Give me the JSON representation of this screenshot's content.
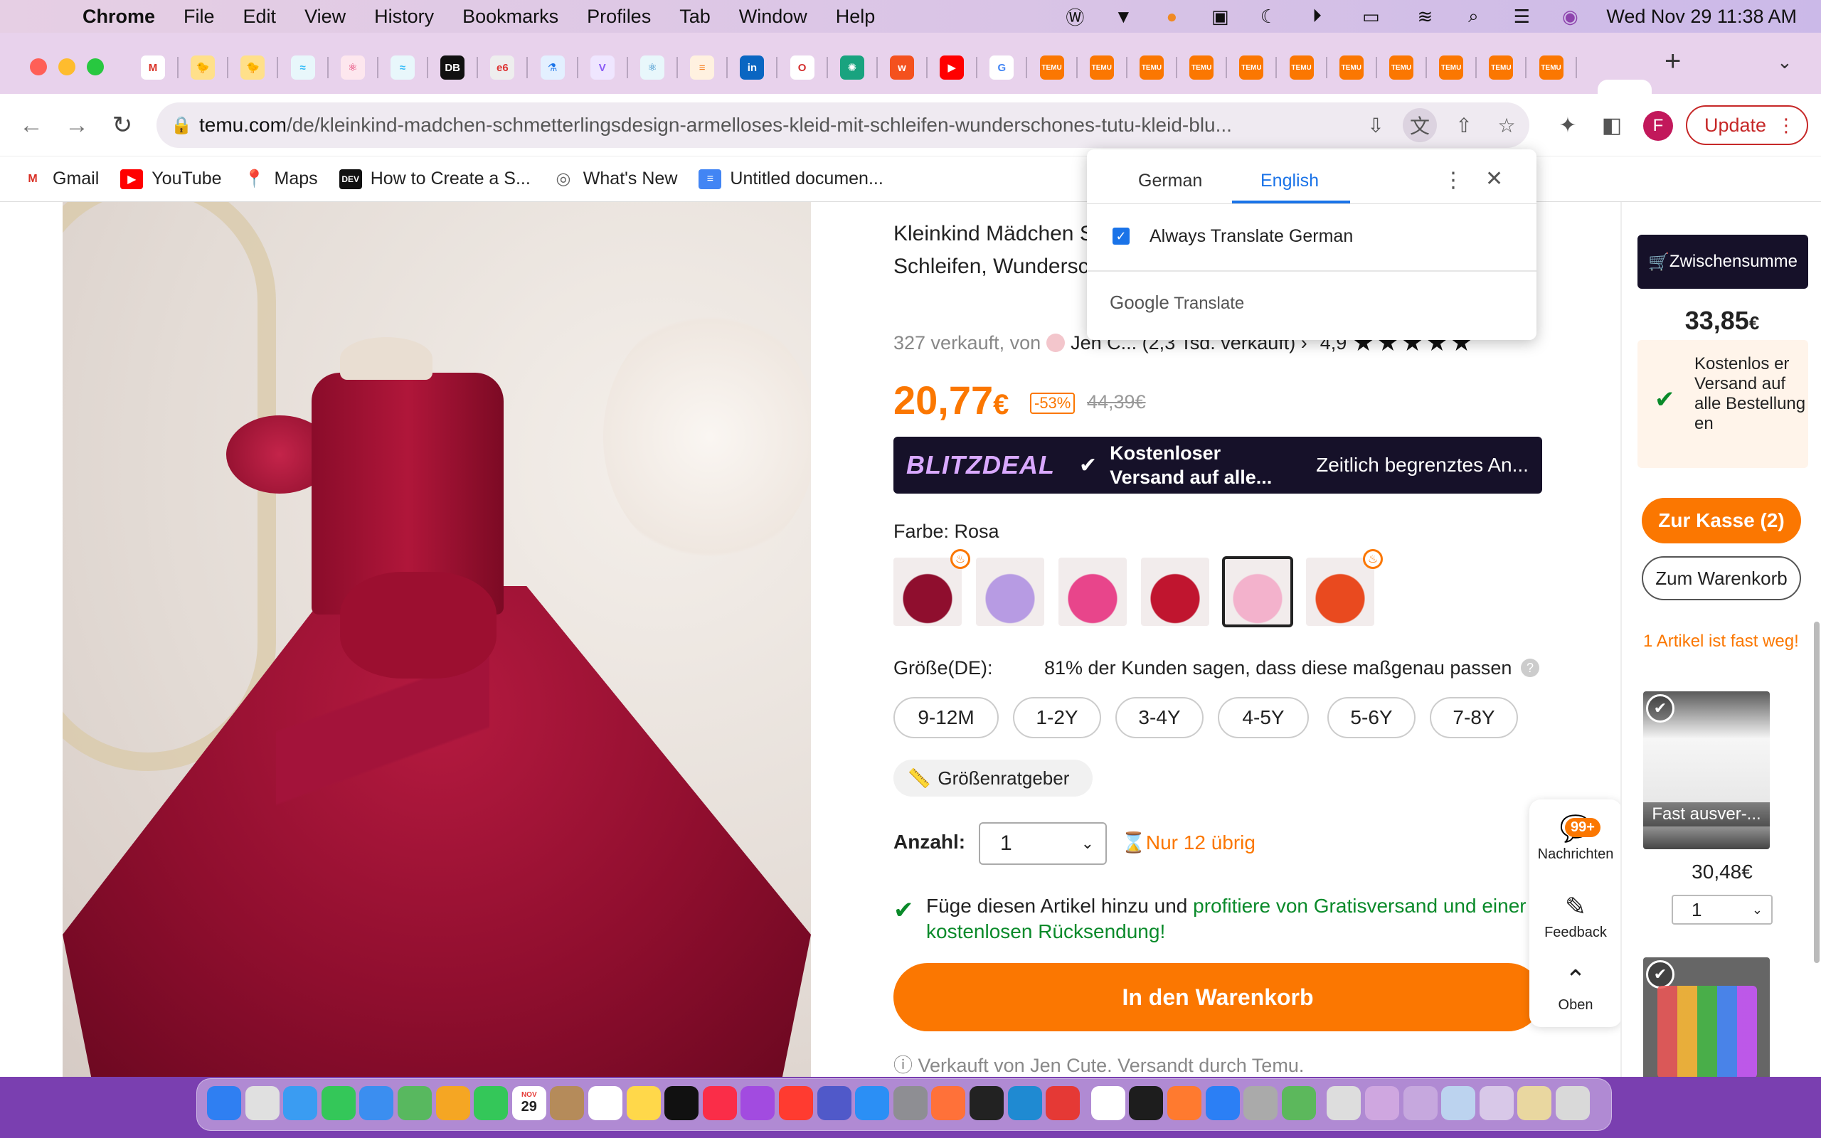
{
  "menubar": {
    "app": "Chrome",
    "items": [
      "File",
      "Edit",
      "View",
      "History",
      "Bookmarks",
      "Profiles",
      "Tab",
      "Window",
      "Help"
    ],
    "datetime": "Wed Nov 29  11:38 AM"
  },
  "tabs": [
    {
      "icon": "gmail-icon",
      "glyph": "M",
      "color": "#ffffff",
      "fg": "#d93025"
    },
    {
      "icon": "chick-icon",
      "glyph": "🐤",
      "color": "#ffe08a",
      "fg": "#333"
    },
    {
      "icon": "chick-icon",
      "glyph": "🐤",
      "color": "#ffe08a",
      "fg": "#333"
    },
    {
      "icon": "tailwind-icon",
      "glyph": "≈",
      "color": "#e8f7fb",
      "fg": "#38bdf8"
    },
    {
      "icon": "react-icon",
      "glyph": "⚛",
      "color": "#fde7ee",
      "fg": "#e0245e"
    },
    {
      "icon": "tailwind-icon",
      "glyph": "≈",
      "color": "#e8f7fb",
      "fg": "#38bdf8"
    },
    {
      "icon": "db-icon",
      "glyph": "DB",
      "color": "#111111",
      "fg": "#fff"
    },
    {
      "icon": "e6-icon",
      "glyph": "e6",
      "color": "#eeeeee",
      "fg": "#d33"
    },
    {
      "icon": "flask-icon",
      "glyph": "⚗",
      "color": "#e3f0ff",
      "fg": "#1a73e8"
    },
    {
      "icon": "vite-icon",
      "glyph": "V",
      "color": "#efe6ff",
      "fg": "#8b5cf6"
    },
    {
      "icon": "react-icon",
      "glyph": "⚛",
      "color": "#e8f7fb",
      "fg": "#2b88c8"
    },
    {
      "icon": "stack-icon",
      "glyph": "≡",
      "color": "#fff1e0",
      "fg": "#f48024"
    },
    {
      "icon": "linkedin-icon",
      "glyph": "in",
      "color": "#0a66c2",
      "fg": "#fff"
    },
    {
      "icon": "opera-icon",
      "glyph": "O",
      "color": "#fff",
      "fg": "#d32f2f"
    },
    {
      "icon": "chatgpt-icon",
      "glyph": "✺",
      "color": "#19a37f",
      "fg": "#fff"
    },
    {
      "icon": "w-icon",
      "glyph": "w",
      "color": "#f4511e",
      "fg": "#fff"
    },
    {
      "icon": "youtube-icon",
      "glyph": "▶",
      "color": "#ff0000",
      "fg": "#fff"
    },
    {
      "icon": "google-icon",
      "glyph": "G",
      "color": "#fff",
      "fg": "#4285f4"
    },
    {
      "icon": "temu-icon",
      "glyph": "TEMU",
      "color": "#fb7701",
      "fg": "#fff"
    },
    {
      "icon": "temu-icon",
      "glyph": "TEMU",
      "color": "#fb7701",
      "fg": "#fff"
    },
    {
      "icon": "temu-icon",
      "glyph": "TEMU",
      "color": "#fb7701",
      "fg": "#fff"
    },
    {
      "icon": "temu-icon",
      "glyph": "TEMU",
      "color": "#fb7701",
      "fg": "#fff"
    },
    {
      "icon": "temu-icon",
      "glyph": "TEMU",
      "color": "#fb7701",
      "fg": "#fff"
    },
    {
      "icon": "temu-icon",
      "glyph": "TEMU",
      "color": "#fb7701",
      "fg": "#fff"
    },
    {
      "icon": "temu-icon",
      "glyph": "TEMU",
      "color": "#fb7701",
      "fg": "#fff"
    },
    {
      "icon": "temu-icon",
      "glyph": "TEMU",
      "color": "#fb7701",
      "fg": "#fff"
    },
    {
      "icon": "temu-icon",
      "glyph": "TEMU",
      "color": "#fb7701",
      "fg": "#fff"
    },
    {
      "icon": "temu-icon",
      "glyph": "TEMU",
      "color": "#fb7701",
      "fg": "#fff"
    },
    {
      "icon": "temu-icon",
      "glyph": "TEMU",
      "color": "#fb7701",
      "fg": "#fff"
    }
  ],
  "toolbar": {
    "url_host": "temu.com",
    "url_path": "/de/kleinkind-madchen-schmetterlingsdesign-armelloses-kleid-mit-schleifen-wunderschones-tutu-kleid-blu...",
    "profile_initial": "F",
    "update_label": "Update"
  },
  "bookmarks": [
    {
      "label": "Gmail",
      "icon": "gmail-icon"
    },
    {
      "label": "YouTube",
      "icon": "youtube-icon"
    },
    {
      "label": "Maps",
      "icon": "maps-icon"
    },
    {
      "label": "How to Create a S...",
      "icon": "dev-icon"
    },
    {
      "label": "What's New",
      "icon": "chrome-icon"
    },
    {
      "label": "Untitled documen...",
      "icon": "docs-icon"
    }
  ],
  "translate": {
    "tab_source": "German",
    "tab_target": "English",
    "always_label": "Always Translate German",
    "footer_brand": "Google",
    "footer_text": " Translate"
  },
  "product": {
    "title": "Kleinkind Mädchen Schmetterlingsdesign Ärmelloses Kleid Mit Schleifen, Wunderschönes Tutu-Kleid Blumenmädchen Kleid",
    "sold": "327 verkauft, von",
    "seller": "Jen C... (2,3 Tsd. verkauft) ›",
    "rating": "4,9",
    "stars": "★★★★★",
    "price": "20,77",
    "currency": "€",
    "discount": "-53%",
    "old_price": "44,39€",
    "blitz_logo": "BLITZDEAL",
    "blitz_text": "Kostenloser Versand auf alle...",
    "blitz_right": "Zeitlich begrenztes An...",
    "color_label": "Farbe: Rosa",
    "swatch_colors": [
      "#8f0e2e",
      "#b79be3",
      "#e8458b",
      "#c0152f",
      "#f3b2cc",
      "#e94a1f"
    ],
    "size_label": "Größe(DE):",
    "fit_text": "81% der Kunden sagen, dass diese maßgenau passen",
    "sizes": [
      "9-12M",
      "1-2Y",
      "3-4Y",
      "4-5Y",
      "5-6Y",
      "7-8Y"
    ],
    "size_guide": "Größenratgeber",
    "qty_label": "Anzahl:",
    "qty_value": "1",
    "stock_left": "Nur 12 übrig",
    "promo_a": "Füge diesen Artikel hinzu und ",
    "promo_b": "profitiere von Gratisversand und einer kostenlosen Rücksendung!",
    "add_to_cart": "In den Warenkorb",
    "sold_by": "Verkauft von Jen Cute. Versandt durch Temu."
  },
  "float": {
    "badge": "99+",
    "messages": "Nachrichten",
    "feedback": "Feedback",
    "top": "Oben"
  },
  "cart": {
    "subtotal_label": "Zwischensumme",
    "subtotal": "33,85",
    "currency": "€",
    "shipping": "Kostenlos er Versand auf alle Bestellung en",
    "checkout": "Zur Kasse (2)",
    "view_cart": "Zum Warenkorb",
    "fast": "1 Artikel ist fast weg!",
    "item_overlay": "Fast ausver-...",
    "item_price": "30,48€",
    "item_qty": "1",
    "colors": {
      "accent": "#fb7701",
      "dark": "#161129",
      "success": "#0a8a2a"
    }
  },
  "dock": {
    "calendar_month": "NOV",
    "calendar_day": "29"
  }
}
